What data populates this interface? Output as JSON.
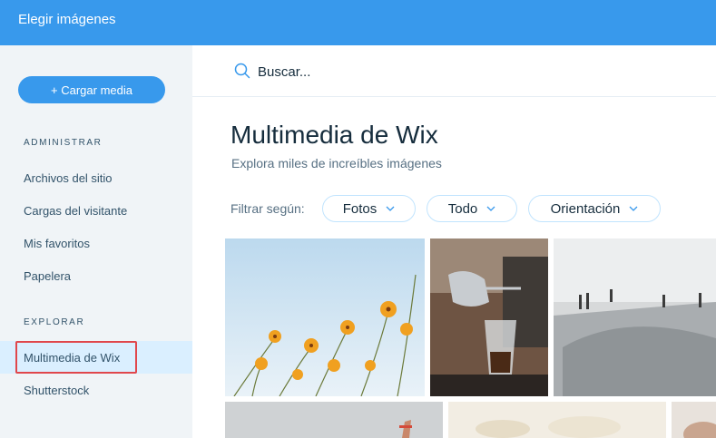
{
  "header": {
    "title": "Elegir imágenes"
  },
  "sidebar": {
    "upload_label": "+ Cargar media",
    "sections": [
      {
        "title": "ADMINISTRAR",
        "items": [
          "Archivos del sitio",
          "Cargas del visitante",
          "Mis favoritos",
          "Papelera"
        ]
      },
      {
        "title": "EXPLORAR",
        "items": [
          "Multimedia de Wix",
          "Shutterstock"
        ]
      }
    ],
    "selected_item": "Multimedia de Wix"
  },
  "search": {
    "placeholder": "Buscar..."
  },
  "main": {
    "title": "Multimedia de Wix",
    "subtitle": "Explora miles de increíbles imágenes",
    "filter_label": "Filtrar según:",
    "filters": [
      "Fotos",
      "Todo",
      "Orientación"
    ]
  },
  "colors": {
    "accent": "#3899ec",
    "sidebar_bg": "#f0f4f7",
    "selected_bg": "#daefff",
    "highlight_border": "#e0474c",
    "text_dark": "#162d3d"
  },
  "icons": {
    "search": "search-icon",
    "dropdown": "chevron-down-icon"
  }
}
